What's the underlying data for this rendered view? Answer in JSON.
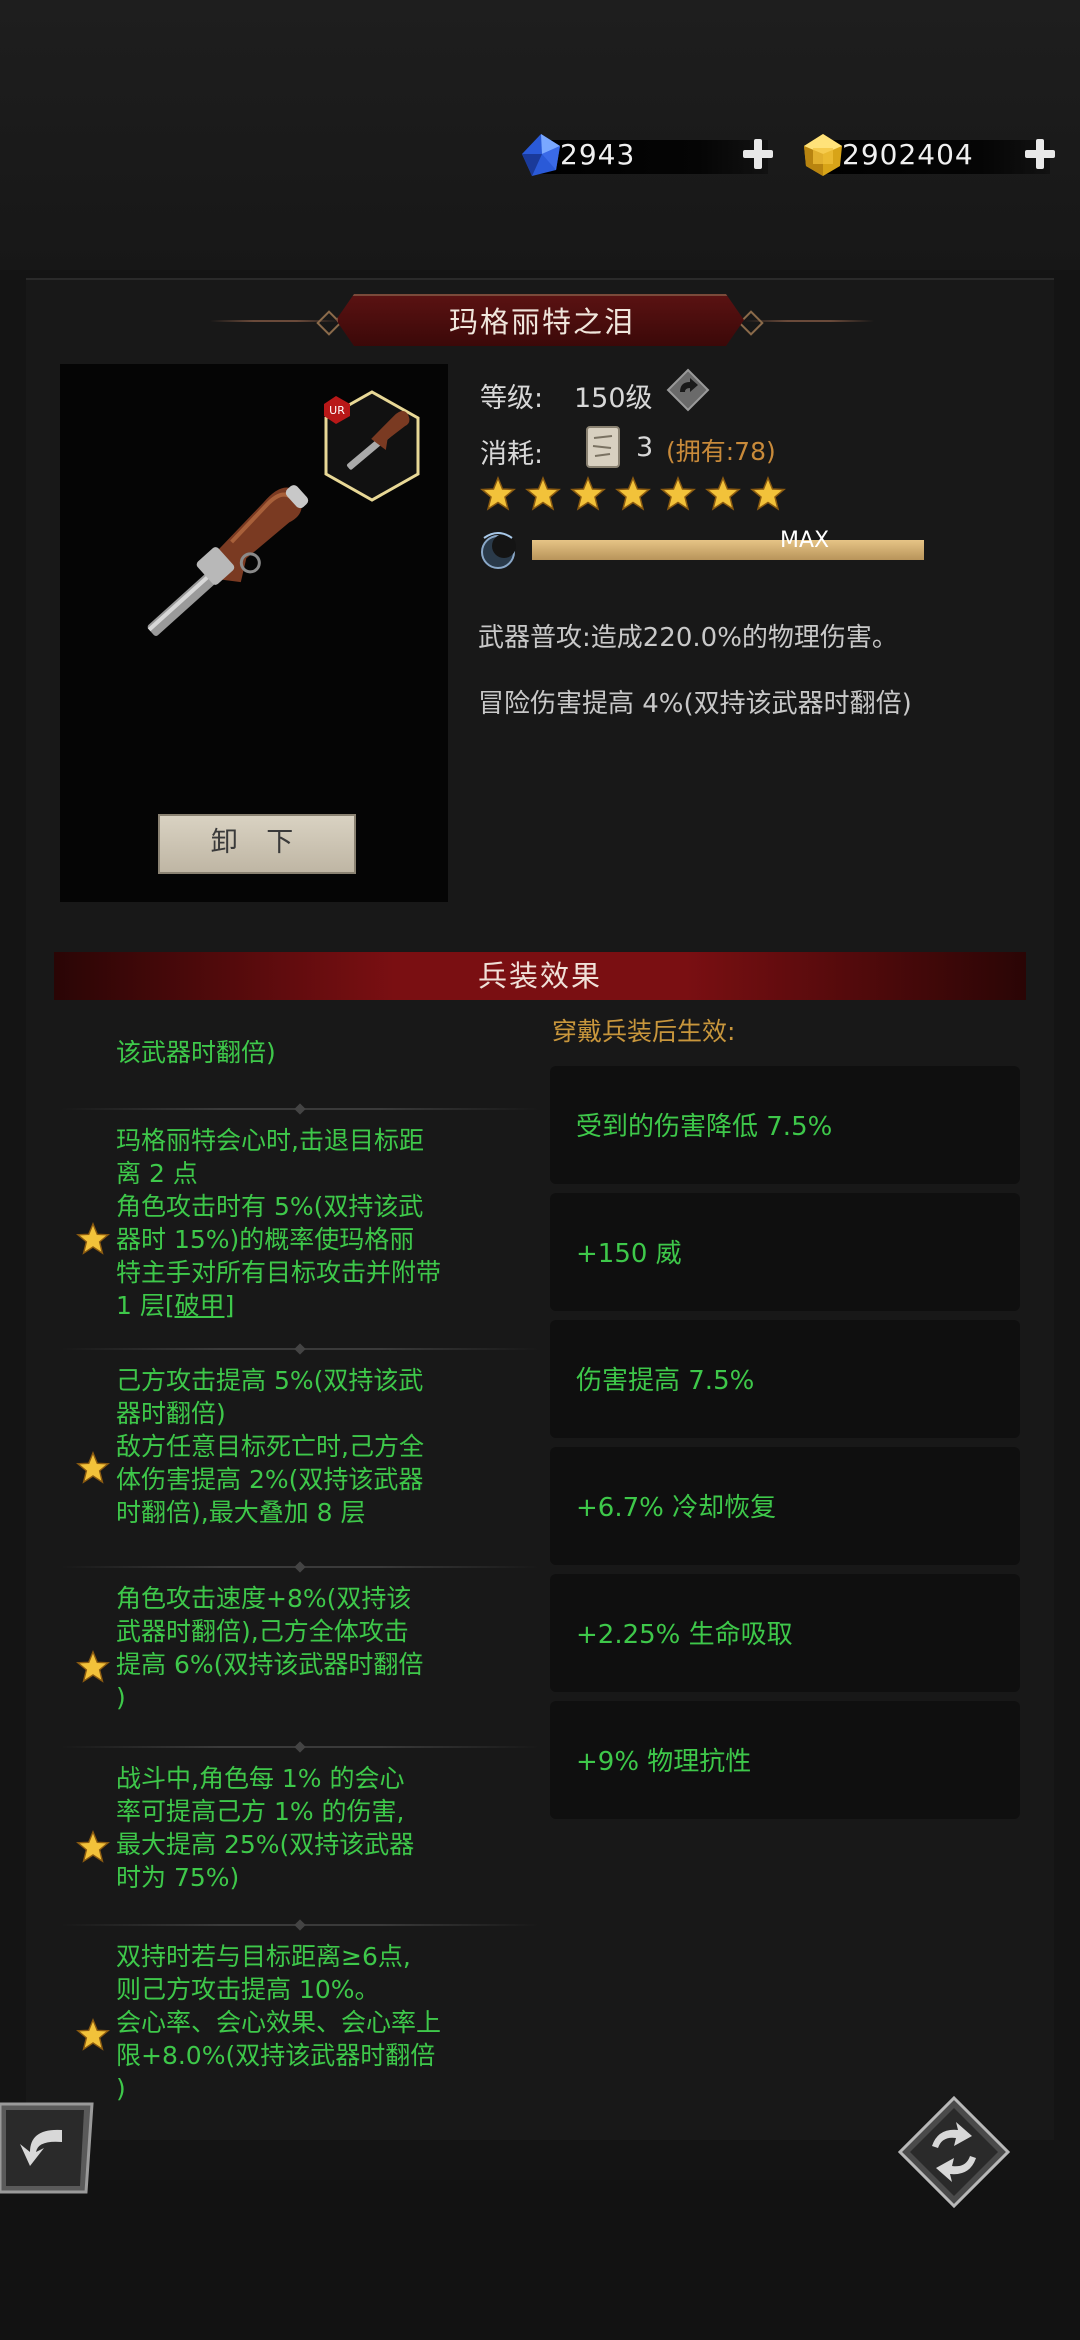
{
  "currency": {
    "gems": "2943",
    "gold": "2902404"
  },
  "weapon": {
    "name": "玛格丽特之泪",
    "rarity_badge": "UR",
    "unload_label": "卸 下",
    "level_label": "等级:",
    "level_value": "150级",
    "cost_label": "消耗:",
    "cost_value": "3",
    "owned": "(拥有:78)",
    "stars": 7,
    "max_label": "MAX",
    "attack_desc": "武器普攻:造成220.0%的物理伤害。",
    "passive_desc": "冒险伤害提高 4%(双持该武器时翻倍)"
  },
  "effects": {
    "section_title": "兵装效果",
    "equip_header": "穿戴兵装后生效:",
    "left_items": [
      {
        "text": "该武器时翻倍)",
        "star": false
      },
      {
        "text": "玛格丽特会心时,击退目标距\n离 2 点\n角色攻击时有 5%(双持该武\n器时 15%)的概率使玛格丽\n特主手对所有目标攻击并附带\n1 层",
        "link": "[破甲]",
        "star": true
      },
      {
        "text": "己方攻击提高 5%(双持该武\n器时翻倍)\n敌方任意目标死亡时,己方全\n体伤害提高 2%(双持该武器\n时翻倍),最大叠加 8 层",
        "star": true
      },
      {
        "text": "角色攻击速度+8%(双持该\n武器时翻倍),己方全体攻击\n提高 6%(双持该武器时翻倍\n)",
        "star": true
      },
      {
        "text": "战斗中,角色每 1% 的会心\n率可提高己方 1% 的伤害,\n最大提高 25%(双持该武器\n时为 75%)",
        "star": true
      },
      {
        "text": "双持时若与目标距离≥6点,\n则己方攻击提高 10%。\n会心率、会心效果、会心率上\n限+8.0%(双持该武器时翻倍\n)",
        "star": true
      }
    ],
    "right_items": [
      "受到的伤害降低 7.5%",
      "+150 威",
      "伤害提高 7.5%",
      "+6.7% 冷却恢复",
      "+2.25% 生命吸取",
      "+9% 物理抗性"
    ]
  },
  "colors": {
    "effect_green": "#3ec84a",
    "owned_orange": "#c88a3a",
    "star_gold": "#f2c23a",
    "title_red": "#5a1212"
  }
}
